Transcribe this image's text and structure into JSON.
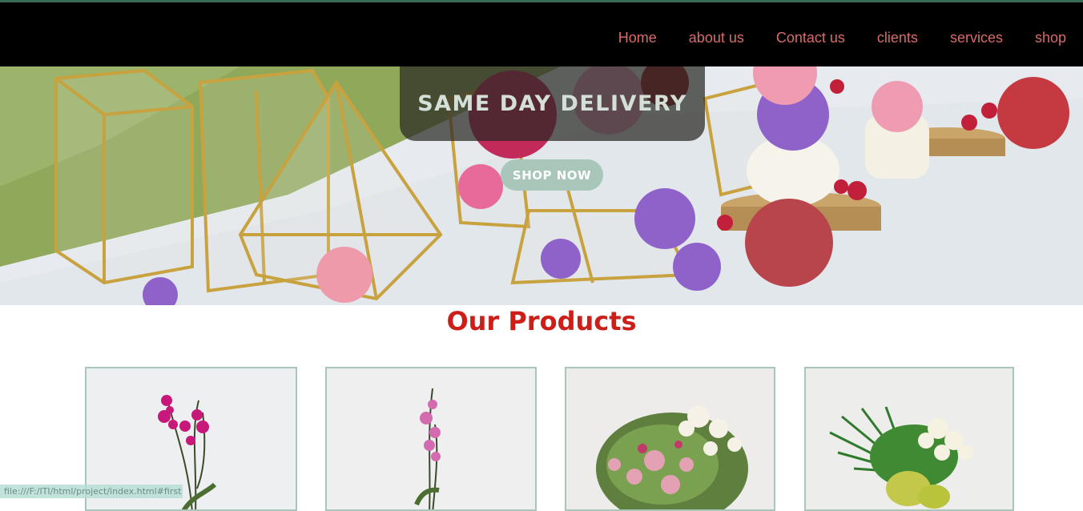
{
  "nav": {
    "links": [
      "Home",
      "about us",
      "Contact us",
      "clients",
      "services",
      "shop"
    ],
    "link_color": "#d96a6a"
  },
  "hero": {
    "title": "SAME DAY DELIVERY",
    "button_label": "SHOP NOW",
    "button_color": "#a9c6bb"
  },
  "products": {
    "title": "Our Products",
    "title_color": "#cc1f1a",
    "items": [
      {
        "image": "magenta-orchid-plant"
      },
      {
        "image": "pink-orchid-plant"
      },
      {
        "image": "mixed-pastel-bouquet"
      },
      {
        "image": "tropical-green-bouquet"
      }
    ]
  },
  "status_bar": {
    "url": "file:///F:/ITI/html/project/index.html#first"
  }
}
